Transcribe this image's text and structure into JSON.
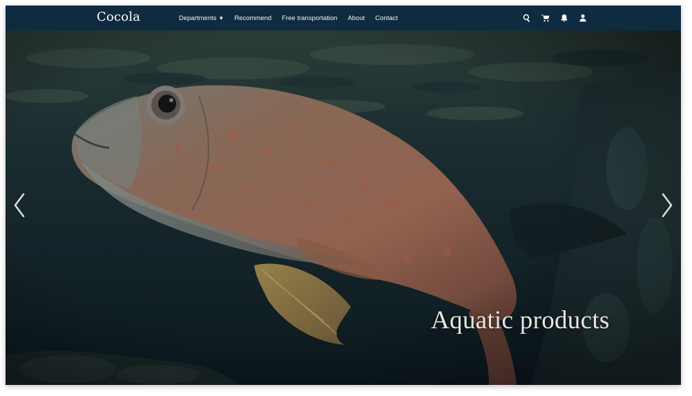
{
  "brand": {
    "name": "Cocola"
  },
  "nav": {
    "links": [
      {
        "label": "Departments",
        "has_dropdown": true,
        "caret": "▼"
      },
      {
        "label": "Recommend"
      },
      {
        "label": "Free transportation"
      },
      {
        "label": "About"
      },
      {
        "label": "Contact"
      }
    ],
    "icons": [
      "search-icon",
      "cart-icon",
      "bell-icon",
      "user-icon"
    ]
  },
  "hero": {
    "caption": "Aquatic products",
    "image_subject": "underwater fish",
    "controls": [
      "previous-slide",
      "next-slide"
    ]
  },
  "colors": {
    "navbar": "#0f2b40",
    "hero_base": "#0d1e26",
    "fish_body": "#b07a5e",
    "caption_text": "#e8e6e0"
  }
}
